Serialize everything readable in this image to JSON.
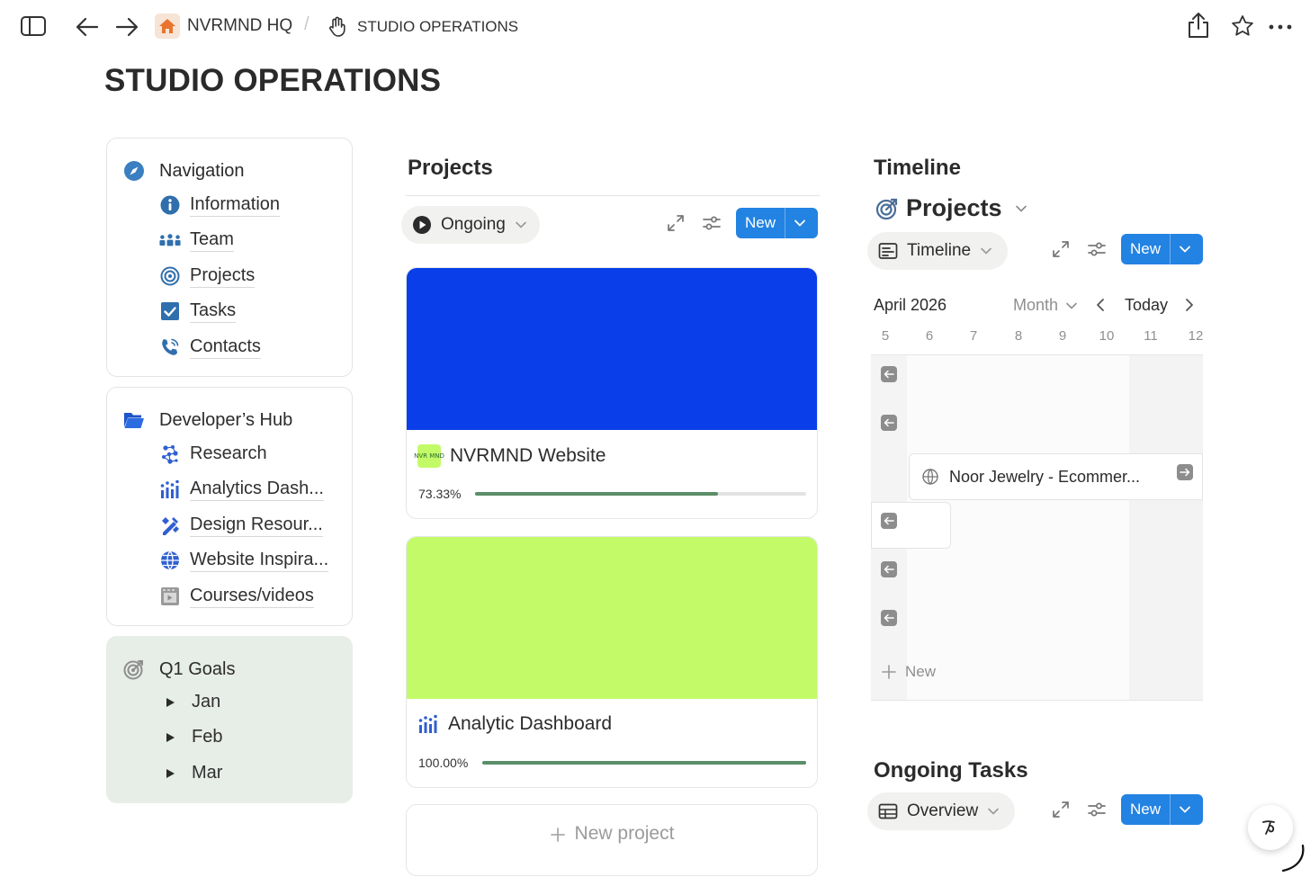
{
  "breadcrumb": {
    "workspace": "NVRMND HQ",
    "separator": "/",
    "page": "STUDIO OPERATIONS"
  },
  "page": {
    "title": "STUDIO OPERATIONS"
  },
  "navigation": {
    "title": "Navigation",
    "items": [
      {
        "label": "Information",
        "icon": "info-icon"
      },
      {
        "label": "Team",
        "icon": "team-icon"
      },
      {
        "label": "Projects",
        "icon": "target-icon"
      },
      {
        "label": "Tasks",
        "icon": "checkbox-icon"
      },
      {
        "label": "Contacts",
        "icon": "phone-icon"
      }
    ]
  },
  "developers_hub": {
    "title": "Developer’s Hub",
    "items": [
      {
        "label": "Research",
        "icon": "research-icon"
      },
      {
        "label": "Analytics Dash...",
        "icon": "analytics-icon"
      },
      {
        "label": "Design Resour...",
        "icon": "design-tools-icon"
      },
      {
        "label": "Website Inspira...",
        "icon": "globe-icon"
      },
      {
        "label": "Courses/videos",
        "icon": "film-icon"
      }
    ]
  },
  "goals": {
    "title": "Q1 Goals",
    "items": [
      "Jan",
      "Feb",
      "Mar"
    ]
  },
  "projects": {
    "title": "Projects",
    "view_label": "Ongoing",
    "new_label": "New",
    "cards": [
      {
        "name": "NVRMND Website",
        "logo_text": "NVR MND",
        "cover_color": "#0a3ee8",
        "progress_text": "73.33%",
        "progress": 0.7333
      },
      {
        "name": "Analytic Dashboard",
        "cover_color": "#c2fb67",
        "progress_text": "100.00%",
        "progress": 1.0
      }
    ],
    "new_project_label": "New project"
  },
  "timeline": {
    "title": "Timeline",
    "db_title": "Projects",
    "view_label": "Timeline",
    "new_label": "New",
    "month": "April 2026",
    "scale": "Month",
    "today": "Today",
    "days": [
      "5",
      "6",
      "7",
      "8",
      "9",
      "10",
      "11",
      "12"
    ],
    "item": "Noor Jewelry - Ecommer...",
    "add_label": "New"
  },
  "tasks": {
    "title": "Ongoing Tasks",
    "view_label": "Overview",
    "new_label": "New"
  },
  "colors": {
    "accent": "#2383e2",
    "progress": "#5b8e68",
    "goals_bg": "#e7ede7"
  }
}
